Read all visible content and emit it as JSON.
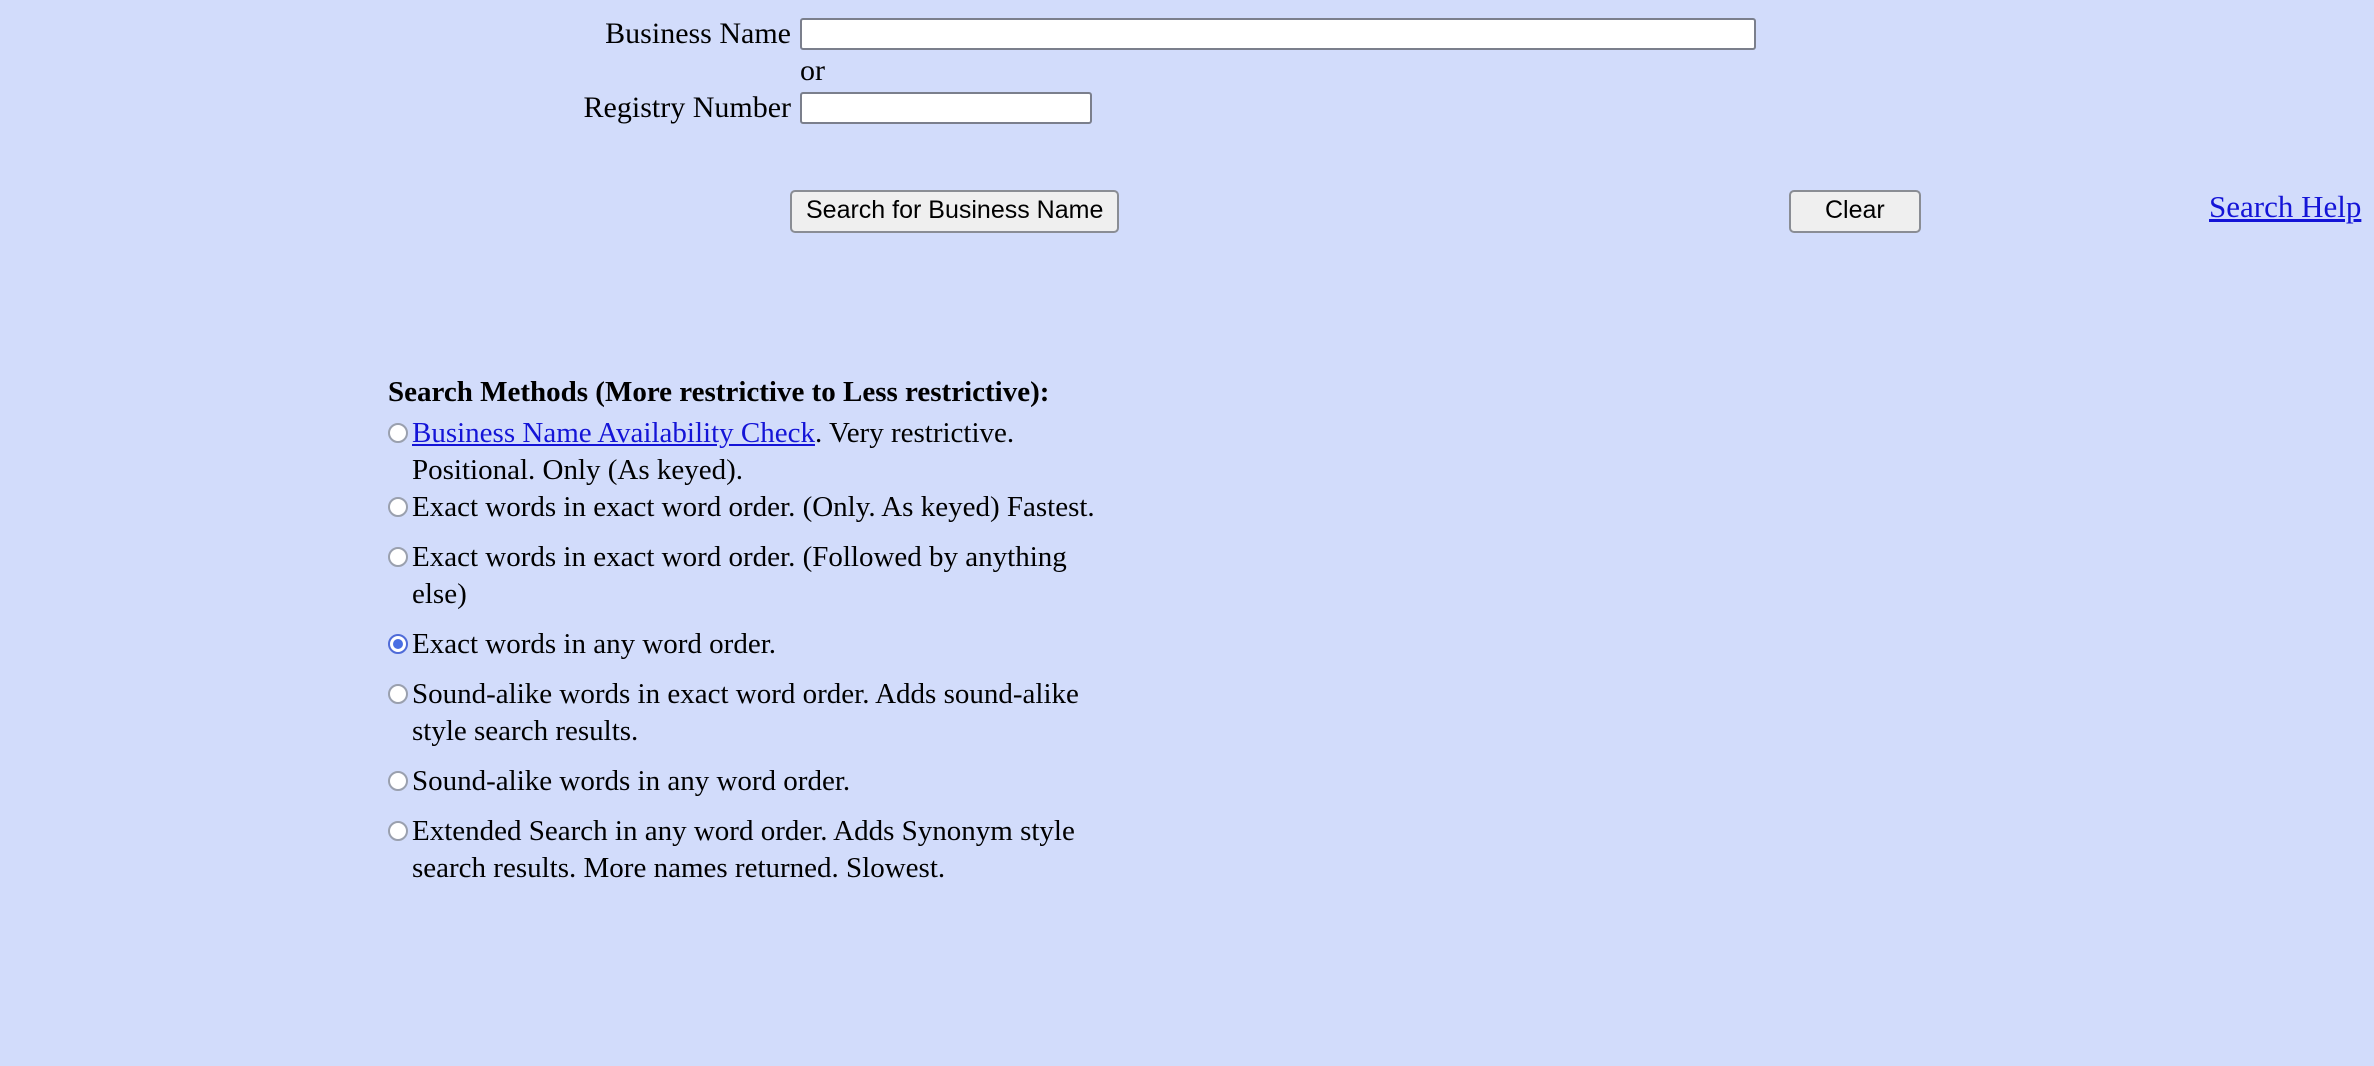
{
  "form": {
    "business_name_label": "Business Name",
    "business_name_value": "",
    "or_text": "or",
    "registry_number_label": "Registry Number",
    "registry_number_value": ""
  },
  "actions": {
    "search_button_label": "Search for Business Name",
    "clear_button_label": "Clear",
    "search_help_link": "Search Help"
  },
  "methods": {
    "heading": "Search Methods (More restrictive to Less restrictive):",
    "options": [
      {
        "link_text": "Business Name Availability Check",
        "text_after_link": ". Very restrictive. Positional. Only (As keyed).",
        "selected": false
      },
      {
        "text": "Exact words in exact word order. (Only. As keyed) Fastest.",
        "selected": false
      },
      {
        "text": "Exact words in exact word order. (Followed by anything else)",
        "selected": false
      },
      {
        "text": "Exact words in any word order.",
        "selected": true
      },
      {
        "text": "Sound-alike words in exact word order. Adds sound-alike style search results.",
        "selected": false
      },
      {
        "text": "Sound-alike words in any word order.",
        "selected": false
      },
      {
        "text": "Extended Search in any word order. Adds Synonym style search results. More names returned. Slowest.",
        "selected": false
      }
    ]
  },
  "colors": {
    "page_background": "#d2dcfb",
    "link": "#1414d7",
    "radio_selected": "#4a6fe3",
    "button_face": "#efefef"
  }
}
